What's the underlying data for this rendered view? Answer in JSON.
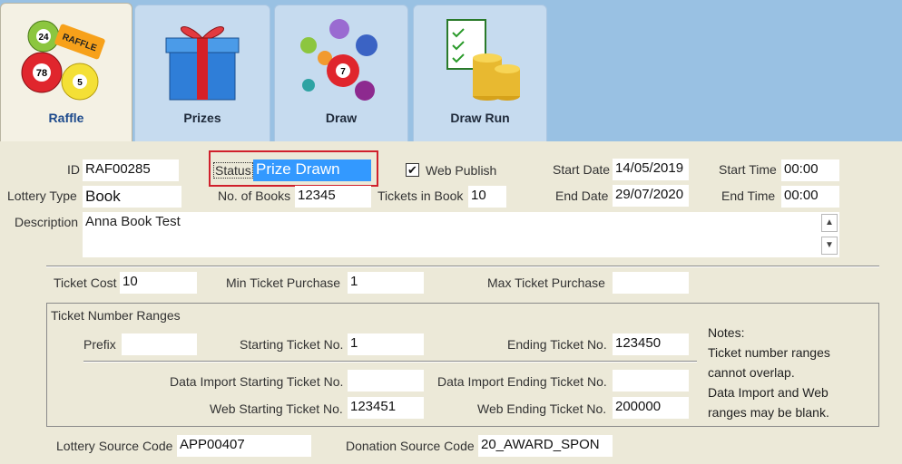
{
  "tabs": [
    {
      "label": "Raffle",
      "icon": "raffle-balls-icon",
      "active": true
    },
    {
      "label": "Prizes",
      "icon": "gift-box-icon",
      "active": false
    },
    {
      "label": "Draw",
      "icon": "lottery-balls-icon",
      "active": false
    },
    {
      "label": "Draw Run",
      "icon": "checklist-coins-icon",
      "active": false
    }
  ],
  "form": {
    "id_label": "ID",
    "id_value": "RAF00285",
    "status_label": "Status",
    "status_value": "Prize Drawn",
    "web_publish_label": "Web Publish",
    "web_publish_checked": true,
    "start_date_label": "Start Date",
    "start_date_value": "14/05/2019",
    "start_time_label": "Start Time",
    "start_time_value": "00:00",
    "lottery_type_label": "Lottery Type",
    "lottery_type_value": "Book",
    "books_label": "No. of Books",
    "books_value": "12345",
    "tickets_in_book_label": "Tickets in Book",
    "tickets_in_book_value": "10",
    "end_date_label": "End Date",
    "end_date_value": "29/07/2020",
    "end_time_label": "End Time",
    "end_time_value": "00:00",
    "description_label": "Description",
    "description_value": "Anna Book Test",
    "ticket_cost_label": "Ticket Cost",
    "ticket_cost_value": "10",
    "min_purchase_label": "Min Ticket Purchase",
    "min_purchase_value": "1",
    "max_purchase_label": "Max Ticket Purchase",
    "max_purchase_value": "",
    "ranges_title": "Ticket Number Ranges",
    "prefix_label": "Prefix",
    "prefix_value": "",
    "starting_no_label": "Starting Ticket No.",
    "starting_no_value": "1",
    "ending_no_label": "Ending Ticket No.",
    "ending_no_value": "123450",
    "import_start_label": "Data Import Starting Ticket No.",
    "import_start_value": "",
    "import_end_label": "Data Import Ending Ticket No.",
    "import_end_value": "",
    "web_start_label": "Web Starting Ticket No.",
    "web_start_value": "123451",
    "web_end_label": "Web Ending Ticket No.",
    "web_end_value": "200000",
    "notes": [
      "Notes:",
      "Ticket number ranges",
      "cannot overlap.",
      "Data Import and Web",
      "ranges may be blank."
    ],
    "lottery_source_label": "Lottery Source Code",
    "lottery_source_value": "APP00407",
    "donation_source_label": "Donation Source Code",
    "donation_source_value": "20_AWARD_SPON"
  },
  "colors": {
    "highlight": "#3399ff",
    "status_border": "#d0202c",
    "tab_strip": "#99c1e3"
  }
}
